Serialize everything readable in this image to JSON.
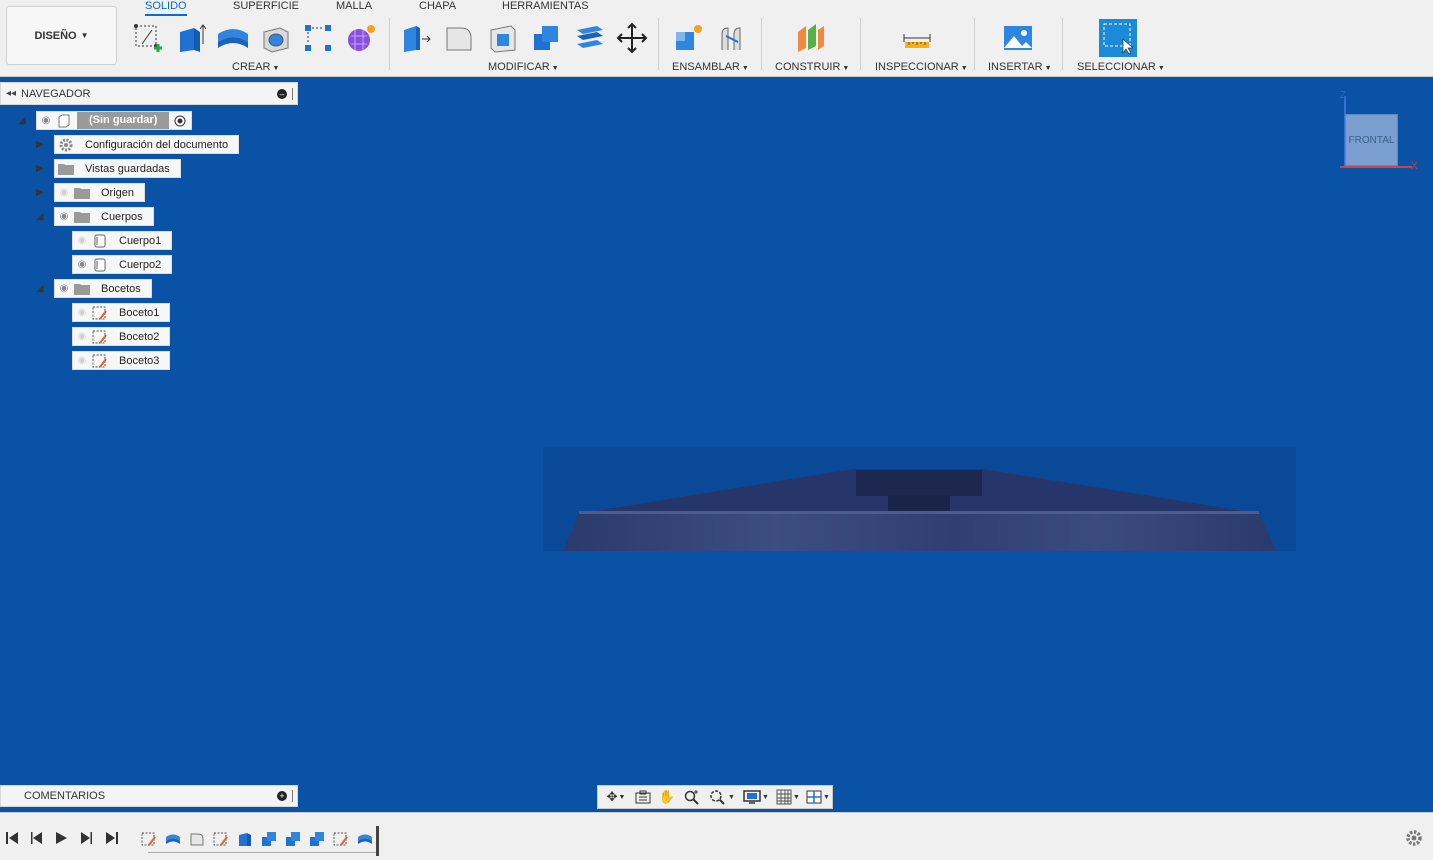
{
  "workspace": {
    "label": "DISEÑO"
  },
  "tabs": [
    "SOLIDO",
    "SUPERFICIE",
    "MALLA",
    "CHAPA",
    "HERRAMIENTAS"
  ],
  "groups": {
    "crear": "CREAR",
    "modificar": "MODIFICAR",
    "ensamblar": "ENSAMBLAR",
    "construir": "CONSTRUIR",
    "inspeccionar": "INSPECCIONAR",
    "insertar": "INSERTAR",
    "seleccionar": "SELECCIONAR"
  },
  "navigator": {
    "title": "NAVEGADOR",
    "root": "(Sin guardar)",
    "items": [
      {
        "label": "Configuración del documento",
        "icon": "gear-icon"
      },
      {
        "label": "Vistas guardadas",
        "icon": "folder-icon"
      },
      {
        "label": "Origen",
        "icon": "folder-icon"
      },
      {
        "label": "Cuerpos",
        "icon": "folder-icon"
      },
      {
        "label": "Cuerpo1",
        "icon": "body-icon"
      },
      {
        "label": "Cuerpo2",
        "icon": "body-icon"
      },
      {
        "label": "Bocetos",
        "icon": "folder-icon"
      },
      {
        "label": "Boceto1",
        "icon": "sketch-icon"
      },
      {
        "label": "Boceto2",
        "icon": "sketch-icon"
      },
      {
        "label": "Boceto3",
        "icon": "sketch-icon"
      }
    ]
  },
  "comments": {
    "title": "COMENTARIOS"
  },
  "viewcube": {
    "face": "FRONTAL",
    "axis_z": "Z",
    "axis_x": "X"
  },
  "colors": {
    "viewport": "#0a52a5",
    "accent": "#0a6bd1",
    "toolbar": "#f0f0f0"
  }
}
